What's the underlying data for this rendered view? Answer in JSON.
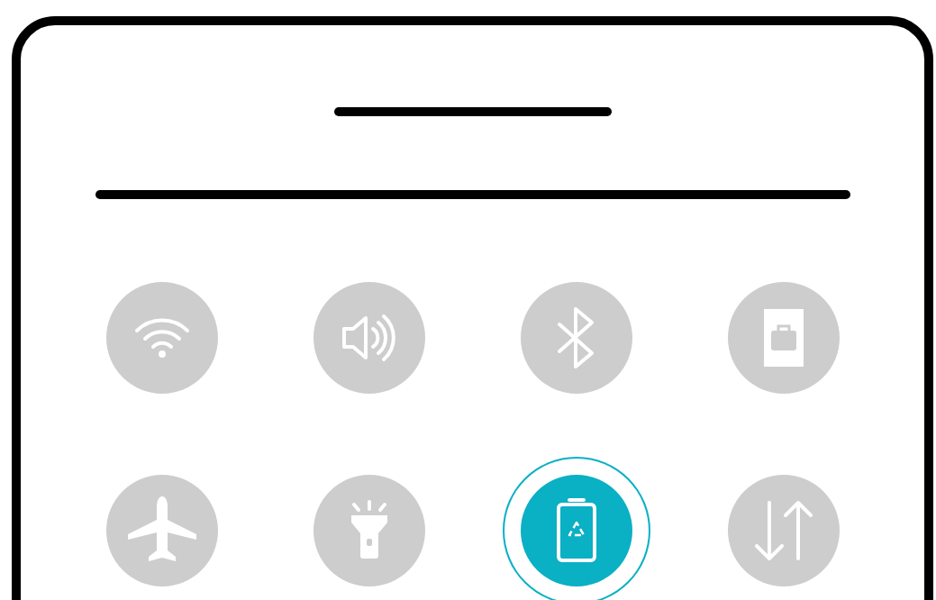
{
  "tiles": [
    {
      "on": false
    },
    {
      "on": false
    },
    {
      "on": false
    },
    {
      "on": false
    },
    {
      "on": false
    },
    {
      "on": false
    },
    {
      "on": true
    },
    {
      "on": false
    }
  ]
}
